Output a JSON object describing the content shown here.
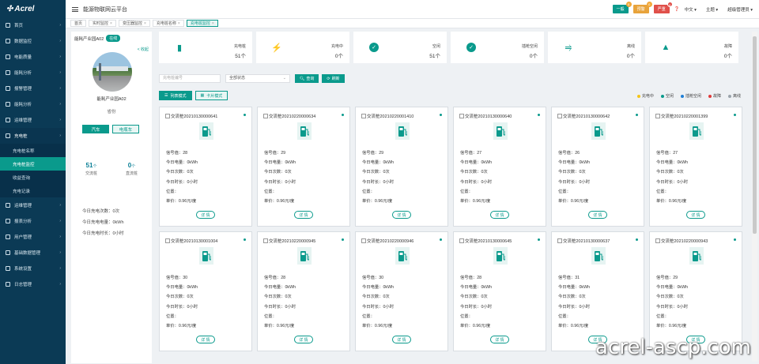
{
  "app": {
    "logo": "Acrel",
    "title": "能源物联网云平台"
  },
  "colors": {
    "accent": "#0a9a8c",
    "sidebar": "#0b3a55"
  },
  "sidebar": {
    "items": [
      {
        "label": "首页",
        "icon": "home-icon"
      },
      {
        "label": "数据监控",
        "icon": "monitor-icon"
      },
      {
        "label": "电能质量",
        "icon": "power-icon"
      },
      {
        "label": "能耗分析",
        "icon": "chart-icon"
      },
      {
        "label": "报警管理",
        "icon": "alarm-icon"
      },
      {
        "label": "能耗分析",
        "icon": "analysis-icon"
      },
      {
        "label": "运维管理",
        "icon": "maintain-icon"
      },
      {
        "label": "充电桩",
        "icon": "charger-icon"
      }
    ],
    "sub": [
      "充电桩名称",
      "充电桩监控",
      "收益查询",
      "充电记录"
    ],
    "items2": [
      {
        "label": "运维管理",
        "icon": "tool-icon"
      },
      {
        "label": "报表分析",
        "icon": "report-icon"
      },
      {
        "label": "用户管理",
        "icon": "user-icon"
      },
      {
        "label": "基础数据管理",
        "icon": "database-icon"
      },
      {
        "label": "系统设置",
        "icon": "settings-icon"
      },
      {
        "label": "日志管理",
        "icon": "log-icon"
      }
    ]
  },
  "topbar": {
    "badges": [
      {
        "label": "一般",
        "count": "0"
      },
      {
        "label": "预警",
        "count": "0"
      },
      {
        "label": "严重",
        "count": "8"
      }
    ],
    "lang": "中文",
    "theme": "主题",
    "user": "超级管理员"
  },
  "tabs": [
    {
      "label": "首页"
    },
    {
      "label": "实时监控"
    },
    {
      "label": "变压器监控"
    },
    {
      "label": "充电桩名称"
    },
    {
      "label": "充电桩监控"
    }
  ],
  "left": {
    "site": "能耗产业园A02",
    "tag": "在线",
    "collapse": "< 收起",
    "name": "能耗产业园A02",
    "sub": "省份",
    "btn_car": "汽车",
    "btn_ebike": "电瓶车",
    "stats": [
      {
        "v": "51",
        "u": "个",
        "l": "交流桩"
      },
      {
        "v": "0",
        "u": "个",
        "l": "直流桩"
      }
    ],
    "lines": [
      "今日充电次数：0次",
      "今日充电电量：0kWh",
      "今日充电时长：0小时"
    ]
  },
  "summary": [
    {
      "label": "充电桩",
      "value": "51个",
      "icon": "charger-icon"
    },
    {
      "label": "充电中",
      "value": "0个",
      "icon": "bolt-icon"
    },
    {
      "label": "空闲",
      "value": "51个",
      "icon": "check-icon"
    },
    {
      "label": "插枪空闲",
      "value": "0个",
      "icon": "plug-check-icon"
    },
    {
      "label": "离线",
      "value": "0个",
      "icon": "unplug-icon"
    },
    {
      "label": "故障",
      "value": "0个",
      "icon": "warning-icon"
    }
  ],
  "filter": {
    "placeholder": "充电桩编号",
    "select": "全部状态",
    "query": "查询",
    "refresh": "刷新"
  },
  "view": {
    "list": "列表模式",
    "card": "卡片模式"
  },
  "legend": [
    {
      "label": "充电中",
      "color": "#f5c518"
    },
    {
      "label": "空闲",
      "color": "#0a9a8c"
    },
    {
      "label": "插枪空闲",
      "color": "#1f7fd6"
    },
    {
      "label": "故障",
      "color": "#e03a3a"
    },
    {
      "label": "离线",
      "color": "#9aa3ab"
    }
  ],
  "cards": [
    {
      "name": "交流桩20210130000641",
      "no": "信号值：28"
    },
    {
      "name": "交流桩20210220000634",
      "no": "信号值：29"
    },
    {
      "name": "交流桩20210220001410",
      "no": "信号值：29"
    },
    {
      "name": "交流桩20210130000640",
      "no": "信号值：27"
    },
    {
      "name": "交流桩20210130000642",
      "no": "信号值：26"
    },
    {
      "name": "交流桩20210220001399",
      "no": "信号值：27"
    },
    {
      "name": "交流桩20210130001004",
      "no": "信号值：30"
    },
    {
      "name": "交流桩20210220000945",
      "no": "信号值：28"
    },
    {
      "name": "交流桩20210220000946",
      "no": "信号值：30"
    },
    {
      "name": "交流桩20210130000645",
      "no": "信号值：28"
    },
    {
      "name": "交流桩20210130000637",
      "no": "信号值：31"
    },
    {
      "name": "交流桩20210220000943",
      "no": "信号值：29"
    }
  ],
  "card_common": {
    "energy": "今日电量：0kWh",
    "times": "今日次数：0次",
    "dur": "今日时长：0小时",
    "pos": "位置：",
    "price": "单价：0.96元/度",
    "detail": "详 情"
  },
  "watermark": "acrel-ascp.com"
}
